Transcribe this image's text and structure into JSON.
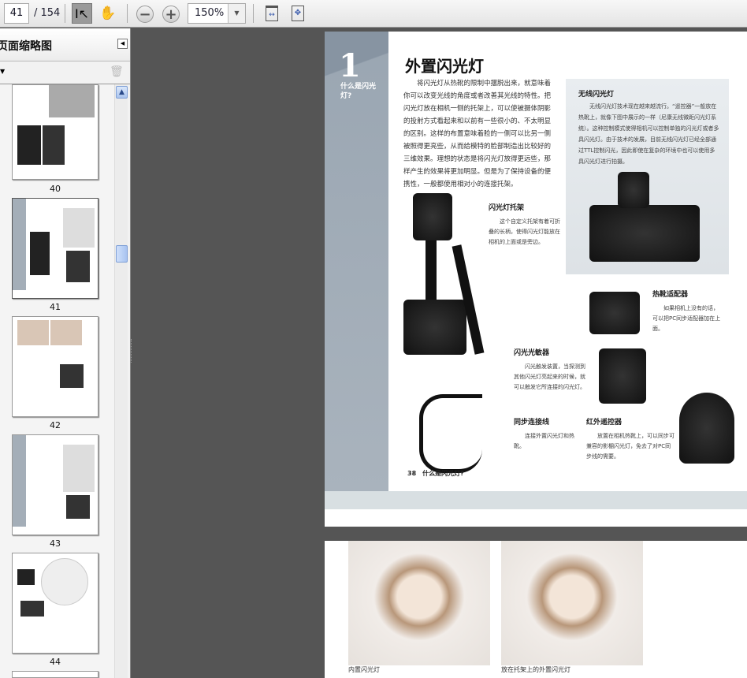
{
  "toolbar": {
    "current_page": "41",
    "total_pages": "/ 154",
    "zoom": "150%",
    "icons": [
      "select-tool-icon",
      "hand-tool-icon",
      "zoom-out-icon",
      "zoom-in-icon",
      "fit-width-icon",
      "fit-page-icon"
    ]
  },
  "sidebar": {
    "title": "页面缩略图",
    "thumbnails": [
      {
        "label": "40"
      },
      {
        "label": "41"
      },
      {
        "label": "42"
      },
      {
        "label": "43"
      },
      {
        "label": "44"
      }
    ]
  },
  "page1": {
    "chapter_number": "1",
    "chapter_title": "什么是闪光灯?",
    "heading": "外置闪光灯",
    "body": "将闪光灯从热靴的限制中摆脱出来，就意味着你可以改变光线的角度或者改善其光线的特性。把闪光灯放在相机一侧的托架上，可以使被摄体阴影的投射方式看起来和以前有一些很小的、不太明显的区别。这样的布置意味着脸的一侧可以比另一侧被照得更亮些，从而给模特的脸部制造出比较好的三维效果。理想的状态是将闪光灯放得更远些，那样产生的效果将更加明显。但是为了保持设备的便携性，一般都使用相对小的连接托架。",
    "sidebox": {
      "title": "无线闪光灯",
      "text": "无线闪光灯技术现在越来越流行。“遥控器”一般放在热靴上，就像下图中展示的一样（尼康无线微距闪光灯系统）。这种控制模式使得相机可以控制单独的闪光灯或者多具闪光灯。由于技术的发展，目前无线闪光灯已经全部通过TTL控制闪光，因此即使在复杂的环境中也可以使用多具闪光灯进行拍摄。"
    },
    "captions": [
      {
        "title": "闪光灯托架",
        "text": "这个自定义托架有着可折叠的长柄，使得闪光灯能放在相机的上面或是旁边。"
      },
      {
        "title": "热靴适配器",
        "text": "如果相机上没有的话，可以把PC同步适配器加在上面。"
      },
      {
        "title": "闪光光敏器",
        "text": "闪光触发装置，当探测到其他闪光灯亮起来的时候，就可以触发它所连接的闪光灯。"
      },
      {
        "title": "同步连接线",
        "text": "连接外置闪光灯和热靴。"
      },
      {
        "title": "红外遥控器",
        "text": "放置在相机热靴上，可以同步可兼容的影棚闪光灯，免去了对PC同步线的需要。"
      }
    ],
    "footer": "38　什么是闪光灯?"
  },
  "page2": {
    "captions": [
      "内置闪光灯",
      "放在托架上的外置闪光灯"
    ]
  }
}
